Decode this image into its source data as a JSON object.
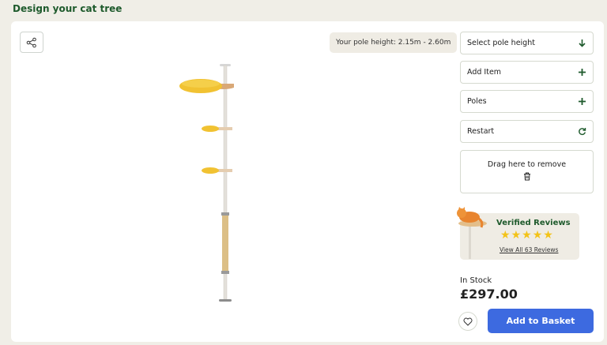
{
  "page": {
    "title": "Design your cat tree"
  },
  "viewer": {
    "share_icon": "share-icon",
    "pole_height_label": "Your pole height: 2.15m - 2.60m"
  },
  "panel": {
    "buttons": [
      {
        "label": "Select pole height",
        "icon": "arrow-down-icon"
      },
      {
        "label": "Add Item",
        "icon": "plus-icon"
      },
      {
        "label": "Poles",
        "icon": "plus-icon"
      },
      {
        "label": "Restart",
        "icon": "refresh-icon"
      }
    ],
    "drop_zone": {
      "label": "Drag here to remove",
      "icon": "trash-icon"
    }
  },
  "reviews": {
    "title": "Verified Reviews",
    "stars": 5,
    "link": "View All 63 Reviews"
  },
  "purchase": {
    "stock": "In Stock",
    "price": "£297.00",
    "favorite_icon": "heart-icon",
    "basket_label": "Add to Basket"
  },
  "colors": {
    "brand_green": "#1e5a2c",
    "accent_blue": "#3d6ae0",
    "star_yellow": "#f3c318",
    "platform_yellow": "#f1c232"
  }
}
